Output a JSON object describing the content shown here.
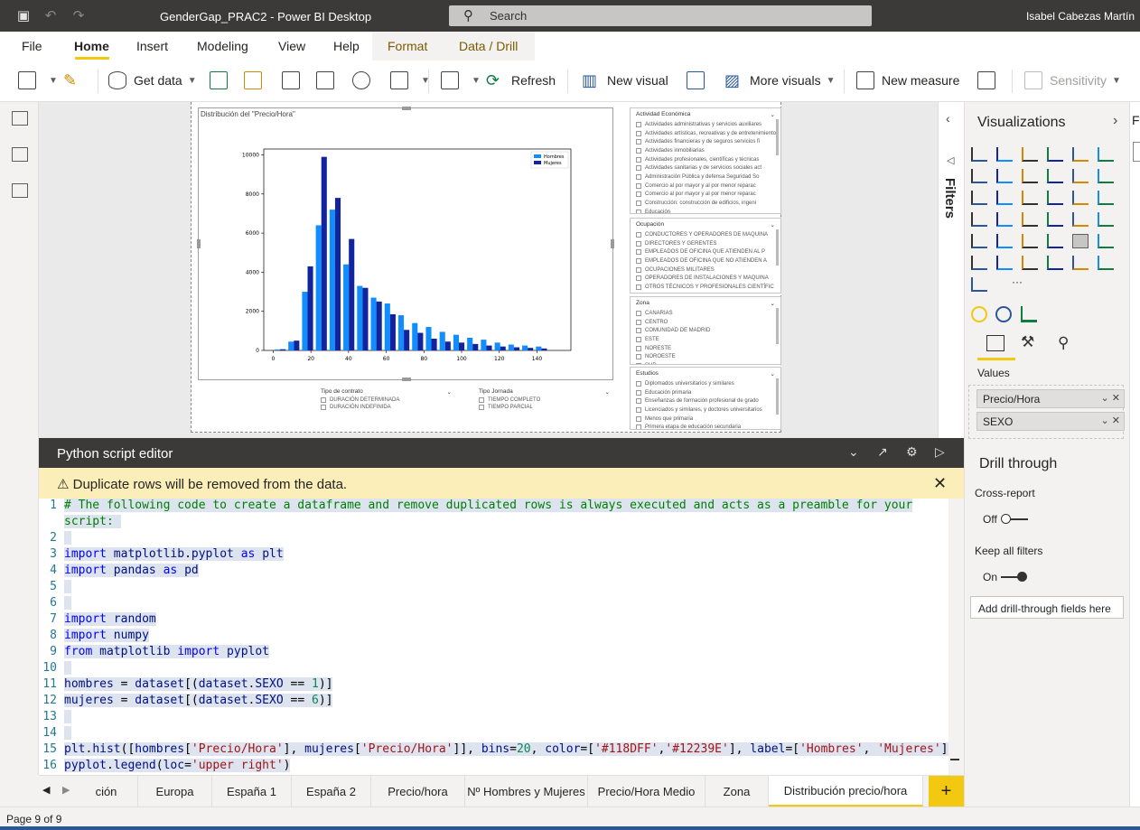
{
  "window": {
    "title": "GenderGap_PRAC2 - Power BI Desktop",
    "search_label": "Search",
    "user": "Isabel Cabezas Martín"
  },
  "menu": {
    "file": "File",
    "home": "Home",
    "insert": "Insert",
    "modeling": "Modeling",
    "view": "View",
    "help": "Help",
    "format": "Format",
    "data_drill": "Data / Drill"
  },
  "ribbon": {
    "get_data": "Get data",
    "refresh": "Refresh",
    "new_visual": "New visual",
    "more_visuals": "More visuals",
    "new_measure": "New measure",
    "sensitivity": "Sensitivity"
  },
  "visual": {
    "title": "Distribución del \"Precio/Hora\""
  },
  "chart_data": {
    "type": "bar",
    "x_ticks": [
      "0",
      "20",
      "40",
      "60",
      "80",
      "100",
      "120",
      "140"
    ],
    "y_ticks": [
      "0",
      "2000",
      "4000",
      "6000",
      "8000",
      "10000"
    ],
    "xlim": [
      -5,
      158
    ],
    "ylim": [
      0,
      10300
    ],
    "legend_position": "top-right",
    "bin_starts": [
      0,
      7.3,
      14.6,
      21.9,
      29.2,
      36.5,
      43.8,
      51.1,
      58.4,
      65.7,
      73.0,
      80.3,
      87.6,
      94.9,
      102.2,
      109.5,
      116.8,
      124.1,
      131.4,
      138.7
    ],
    "bin_width": 7.3,
    "series": [
      {
        "name": "Hombres",
        "color": "#118DFF",
        "values": [
          50,
          450,
          3000,
          6400,
          7200,
          4400,
          3300,
          2700,
          2400,
          1800,
          1400,
          1200,
          950,
          800,
          650,
          550,
          400,
          300,
          250,
          200
        ]
      },
      {
        "name": "Mujeres",
        "color": "#12239E",
        "values": [
          60,
          500,
          4300,
          9900,
          7800,
          5700,
          3200,
          2500,
          1850,
          1050,
          900,
          600,
          450,
          400,
          330,
          250,
          200,
          160,
          130,
          100
        ]
      }
    ]
  },
  "slicers": {
    "actividad": {
      "title": "Actividad Económica",
      "items": [
        "Actividades administrativas y servicios auxiliares",
        "Actividades artísticas, recreativas y de entretenimiento",
        "Actividades financieras y de seguros servicios fi",
        "Actividades inmobiliarias",
        "Actividades profesionales, científicas y técnicas",
        "Actividades sanitarias y de servicios sociales act",
        "Administración Pública y defensa Seguridad So",
        "Comercio al por mayor y al por menor reparac",
        "Comercio al por mayor y al por menor reparac",
        "Construcción: construcción de edificios, ingeni",
        "Educación"
      ]
    },
    "ocupacion": {
      "title": "Ocupación",
      "items": [
        "CONDUCTORES Y OPERADORES DE MAQUINA",
        "DIRECTORES Y GERENTES",
        "EMPLEADOS DE OFICINA QUE ATIENDEN AL P",
        "EMPLEADOS DE OFICINA QUE NO ATIENDEN A",
        "OCUPACIONES MILITARES",
        "OPERADORES DE INSTALACIONES Y MAQUINA",
        "OTROS TÉCNICOS Y PROFESIONALES CIENTÍFIC"
      ]
    },
    "zona": {
      "title": "Zona",
      "items": [
        "CANARIAS",
        "CENTRO",
        "COMUNIDAD DE MADRID",
        "ESTE",
        "NORESTE",
        "NOROESTE",
        "SUR"
      ]
    },
    "estudios": {
      "title": "Estudios",
      "items": [
        "Diplomados universitarios y similares",
        "Educación primaria",
        "Enseñanzas de formación profesional de grado",
        "Licenciados y similares, y doctores universitarios",
        "Menos que primaria",
        "Primera etapa de educación secundaria"
      ]
    },
    "tipo_contrato": {
      "title": "Tipo de contrato",
      "items": [
        "DURACIÓN DETERMINADA",
        "DURACIÓN INDEFINIDA"
      ]
    },
    "tipo_jornada": {
      "title": "Tipo Jornada",
      "items": [
        "TIEMPO COMPLETO",
        "TIEMPO PARCIAL"
      ]
    }
  },
  "editor": {
    "title": "Python script editor",
    "warning": "Duplicate rows will be removed from the data."
  },
  "code_lines": [
    {
      "num": "1",
      "text": "# The following code to create a dataframe and remove duplicated rows is always executed and acts as a preamble for your"
    },
    {
      "num": "",
      "text": "script: "
    },
    {
      "num": "2",
      "text": ""
    },
    {
      "num": "3",
      "text": "import matplotlib.pyplot as plt"
    },
    {
      "num": "4",
      "text": "import pandas as pd"
    },
    {
      "num": "5",
      "text": ""
    },
    {
      "num": "6",
      "text": ""
    },
    {
      "num": "7",
      "text": "import random"
    },
    {
      "num": "8",
      "text": "import numpy"
    },
    {
      "num": "9",
      "text": "from matplotlib import pyplot"
    },
    {
      "num": "10",
      "text": ""
    },
    {
      "num": "11",
      "text": "hombres = dataset[(dataset.SEXO == 1)]"
    },
    {
      "num": "12",
      "text": "mujeres = dataset[(dataset.SEXO == 6)]"
    },
    {
      "num": "13",
      "text": ""
    },
    {
      "num": "14",
      "text": ""
    },
    {
      "num": "15",
      "text": "plt.hist([hombres['Precio/Hora'], mujeres['Precio/Hora']], bins=20, color=['#118DFF','#12239E'], label=['Hombres', 'Mujeres'])"
    },
    {
      "num": "16",
      "text": "pyplot.legend(loc='upper right')"
    }
  ],
  "tabs": [
    "ción",
    "Europa",
    "España 1",
    "España 2",
    "Precio/hora",
    "Nº Hombres y Mujeres",
    "Precio/Hora Medio",
    "Zona",
    "Distribución precio/hora"
  ],
  "status": {
    "page": "Page 9 of 9"
  },
  "filters": {
    "label": "Filters"
  },
  "viz": {
    "title": "Visualizations",
    "values_label": "Values",
    "fields": [
      "Precio/Hora",
      "SEXO"
    ],
    "drill_title": "Drill through",
    "cross_report": "Cross-report",
    "off": "Off",
    "keep_filters": "Keep all filters",
    "on": "On",
    "add_drill": "Add drill-through fields here",
    "more": "···"
  }
}
